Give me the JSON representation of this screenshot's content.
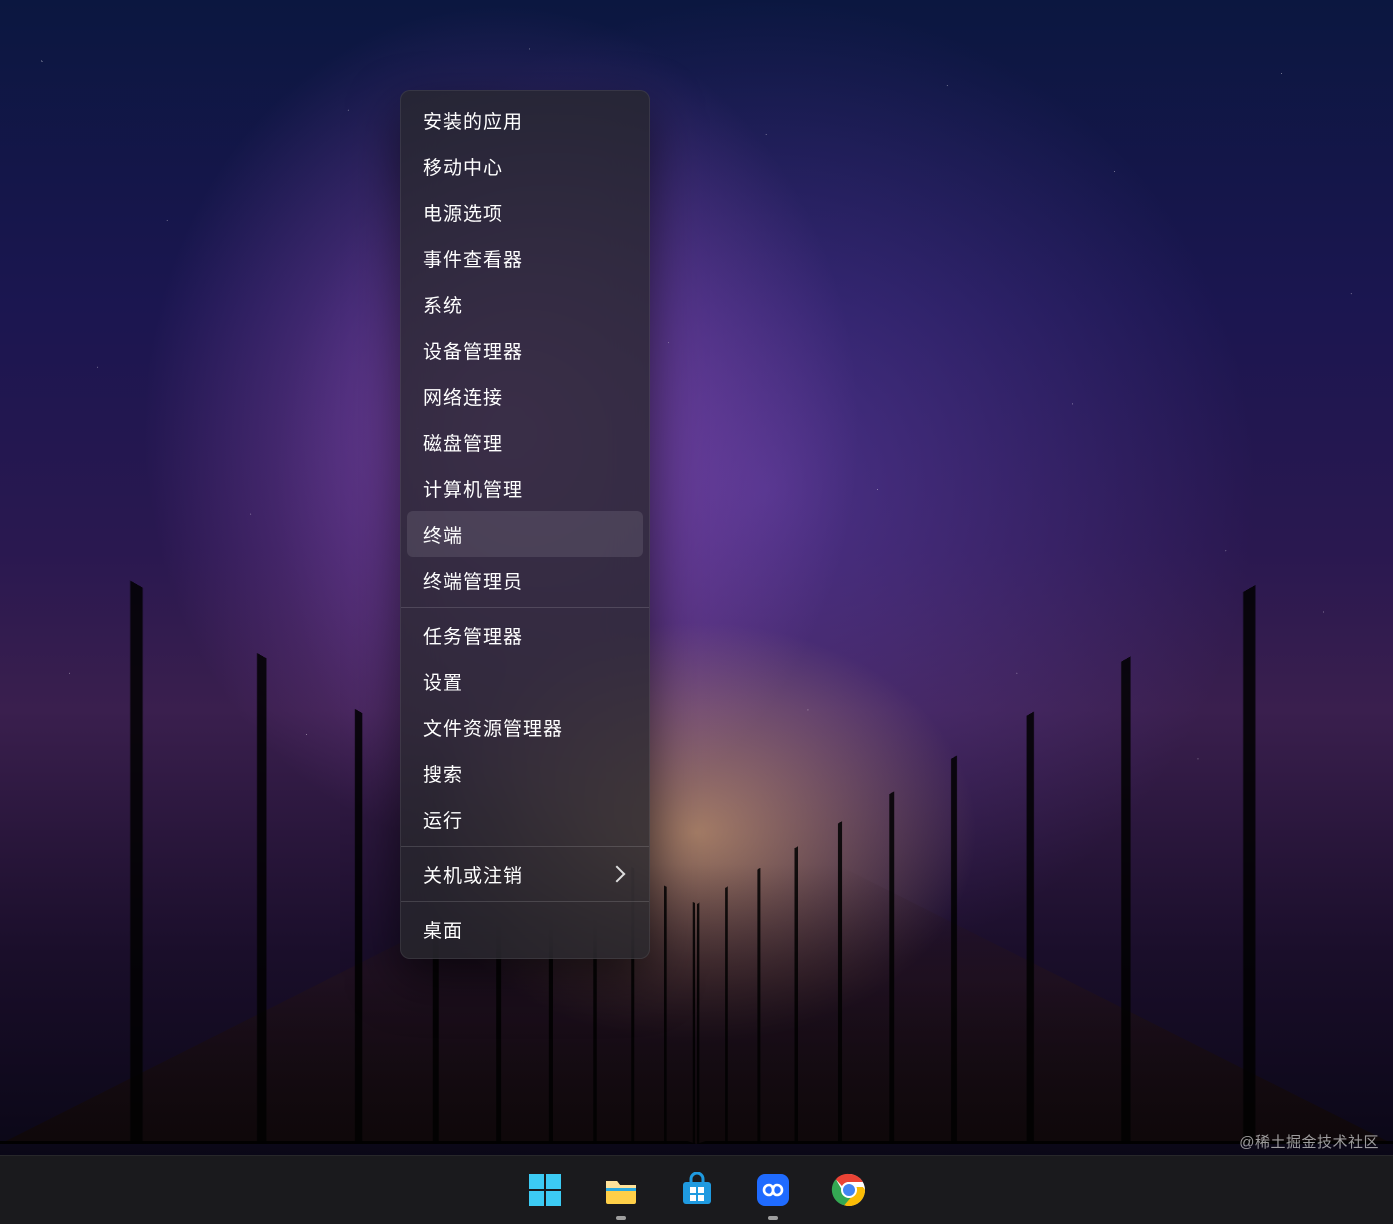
{
  "context_menu": {
    "groups": [
      [
        {
          "id": "installed-apps",
          "label": "安装的应用"
        },
        {
          "id": "mobility-center",
          "label": "移动中心"
        },
        {
          "id": "power-options",
          "label": "电源选项"
        },
        {
          "id": "event-viewer",
          "label": "事件查看器"
        },
        {
          "id": "system",
          "label": "系统"
        },
        {
          "id": "device-manager",
          "label": "设备管理器"
        },
        {
          "id": "network-connections",
          "label": "网络连接"
        },
        {
          "id": "disk-management",
          "label": "磁盘管理"
        },
        {
          "id": "computer-management",
          "label": "计算机管理"
        },
        {
          "id": "terminal",
          "label": "终端",
          "highlighted": true
        },
        {
          "id": "terminal-admin",
          "label": "终端管理员"
        }
      ],
      [
        {
          "id": "task-manager",
          "label": "任务管理器"
        },
        {
          "id": "settings",
          "label": "设置"
        },
        {
          "id": "file-explorer",
          "label": "文件资源管理器"
        },
        {
          "id": "search",
          "label": "搜索"
        },
        {
          "id": "run",
          "label": "运行"
        }
      ],
      [
        {
          "id": "shutdown-signout",
          "label": "关机或注销",
          "submenu": true
        }
      ],
      [
        {
          "id": "desktop",
          "label": "桌面"
        }
      ]
    ]
  },
  "taskbar": {
    "items": [
      {
        "id": "start",
        "name": "start-button",
        "running": false
      },
      {
        "id": "explorer",
        "name": "file-explorer-icon",
        "running": true
      },
      {
        "id": "msstore",
        "name": "microsoft-store-icon",
        "running": false
      },
      {
        "id": "app",
        "name": "pinned-app-icon",
        "running": true
      },
      {
        "id": "chrome",
        "name": "chrome-icon",
        "running": false
      }
    ]
  },
  "watermark": "@稀土掘金技术社区"
}
